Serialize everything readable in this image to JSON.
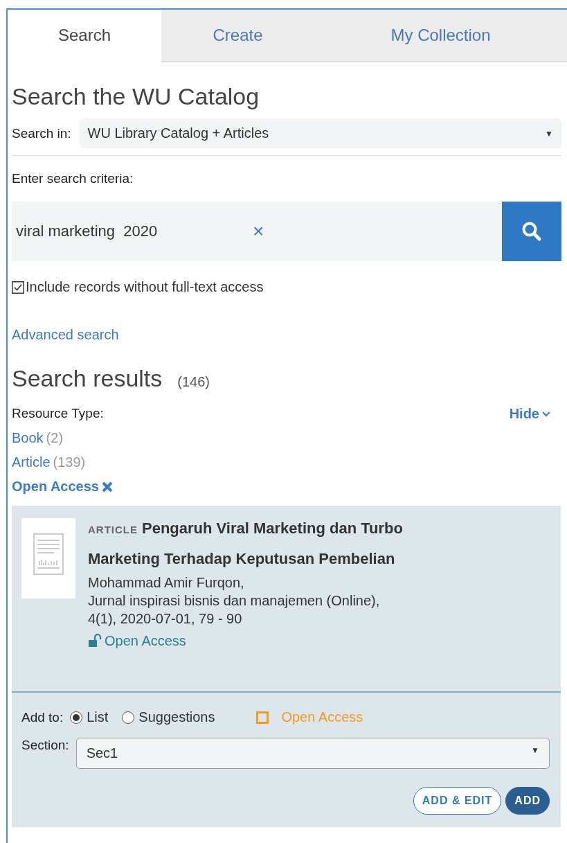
{
  "tabs": [
    {
      "label": "Search",
      "selected": true
    },
    {
      "label": "Create",
      "selected": false
    },
    {
      "label": "My Collection",
      "selected": false
    }
  ],
  "heading": "Search the WU Catalog",
  "search_in": {
    "label": "Search in:",
    "value": "WU Library Catalog + Articles",
    "caret": "▼"
  },
  "criteria": {
    "label": "Enter search criteria:",
    "value": "viral marketing  2020",
    "clear": "×"
  },
  "include_records": {
    "label": "Include records without full-text access",
    "checked": true
  },
  "advanced_search": "Advanced search",
  "results": {
    "title": "Search results",
    "count": "(146)"
  },
  "facets": {
    "label": "Resource Type:",
    "toggle": "Hide",
    "items": [
      {
        "label": "Book",
        "count": "(2)",
        "removable": false
      },
      {
        "label": "Article",
        "count": "(139)",
        "removable": false
      },
      {
        "label": "Open Access",
        "removable": true
      }
    ]
  },
  "result": {
    "type": "ARTICLE",
    "title": "Pengaruh Viral Marketing dan Turbo Marketing Terhadap Keputusan Pembelian",
    "author": "Mohammad Amir Furqon,",
    "source": "Jurnal inspirasi bisnis dan manajemen (Online),",
    "details": "4(1), 2020-07-01, 79 - 90",
    "access": "Open Access"
  },
  "add_to": {
    "label": "Add to:",
    "options": [
      {
        "label": "List",
        "selected": true
      },
      {
        "label": "Suggestions",
        "selected": false
      }
    ],
    "open_access": {
      "label": "Open Access",
      "checked": false
    }
  },
  "section": {
    "label": "Section:",
    "value": "Sec1",
    "caret": "▼"
  },
  "buttons": [
    {
      "label": "ADD & EDIT",
      "kind": "outline"
    },
    {
      "label": "ADD",
      "kind": "solid"
    }
  ]
}
